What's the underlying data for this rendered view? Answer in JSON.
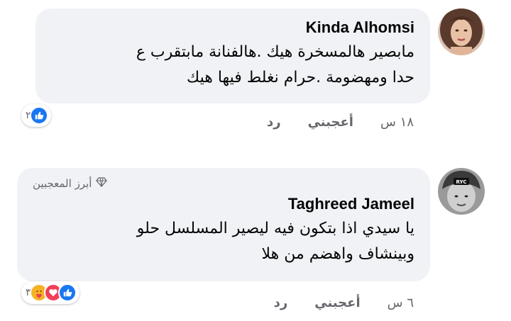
{
  "comments": [
    {
      "author": "Kinda Alhomsi",
      "lines": [
        "مابصير هالمسخرة هيك .هالفنانة مابتقرب ع",
        "حدا ومهضومة .حرام نغلط فيها هيك"
      ],
      "reaction_count": "٢",
      "reactions": [
        "like-icon"
      ],
      "time": "١٨ س",
      "like_label": "أعجبني",
      "reply_label": "رد"
    },
    {
      "badge": "أبرز المعجبين",
      "author": "Taghreed Jameel",
      "lines": [
        "يا سيدي اذا بتكون فيه ليصير المسلسل حلو",
        "وبينشاف واهضم من هلا"
      ],
      "reaction_count": "٣",
      "reactions": [
        "care-icon",
        "love-icon",
        "like-icon"
      ],
      "time": "٦ س",
      "like_label": "أعجبني",
      "reply_label": "رد"
    }
  ],
  "colors": {
    "bubble": "#f0f2f5",
    "like": "#1877f2",
    "love": "#f33e58",
    "care": "#f7b125"
  }
}
